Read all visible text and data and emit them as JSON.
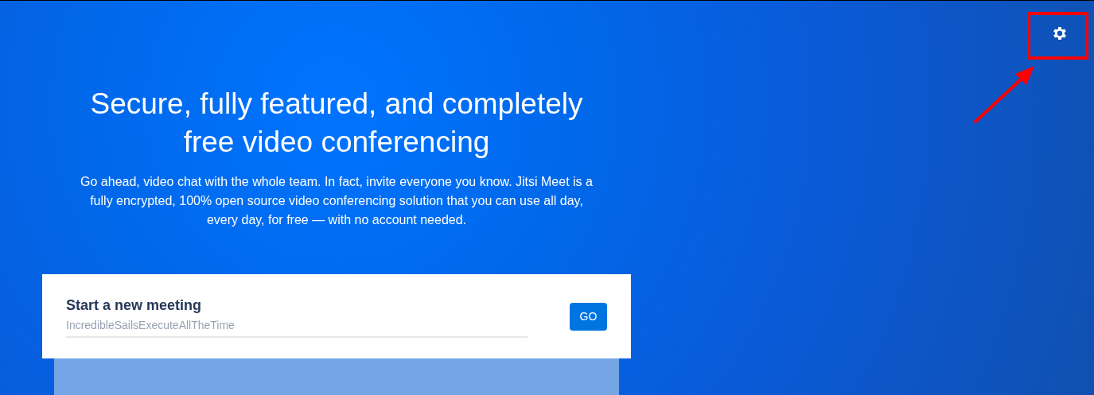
{
  "header": {
    "title": "Secure, fully featured, and completely free video conferencing",
    "description": "Go ahead, video chat with the whole team. In fact, invite everyone you know. Jitsi Meet is a fully encrypted, 100% open source video conferencing solution that you can use all day, every day, for free — with no account needed."
  },
  "meeting_card": {
    "title": "Start a new meeting",
    "placeholder": "IncredibleSailsExecuteAllTheTime",
    "button": "GO"
  }
}
